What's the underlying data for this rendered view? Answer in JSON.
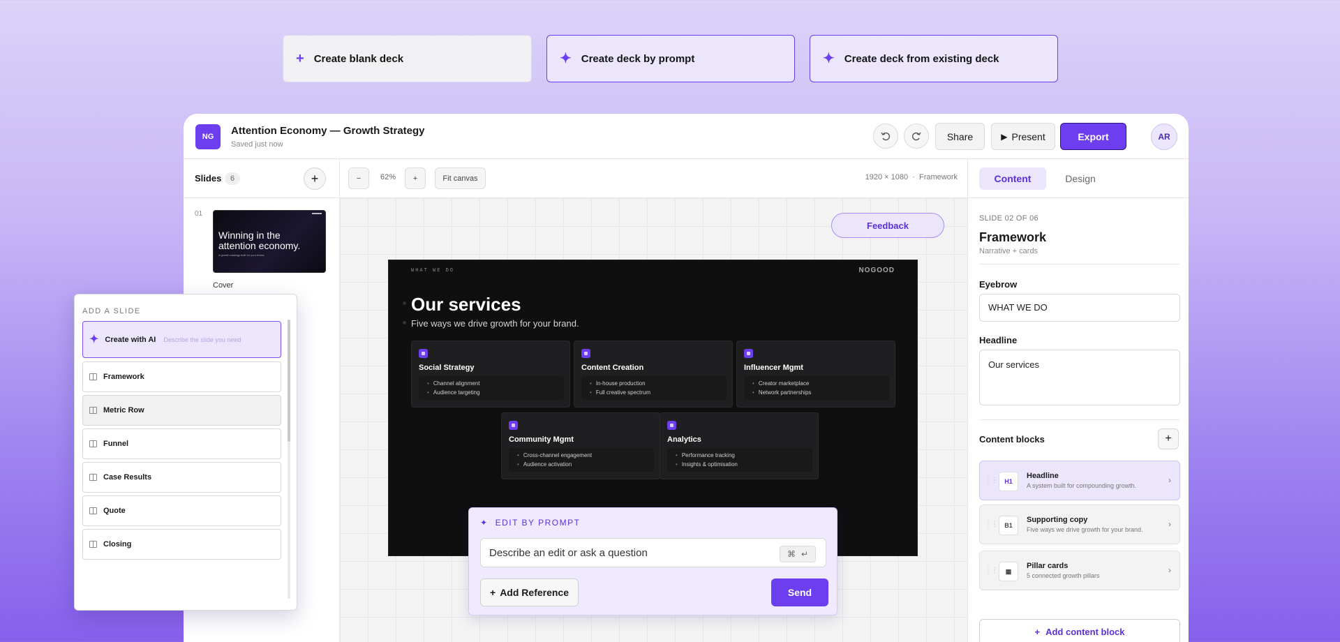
{
  "top_actions": [
    {
      "label": "Create blank deck",
      "icon": "plus-icon"
    },
    {
      "label": "Create deck by prompt",
      "icon": "sparkle-icon"
    },
    {
      "label": "Create deck from existing deck",
      "icon": "sparkle-icon"
    }
  ],
  "header": {
    "logo": "NG",
    "title": "Attention Economy — Growth Strategy",
    "status": "Saved just now",
    "share": "Share",
    "present": "Present",
    "export": "Export",
    "avatar": "AR"
  },
  "sidebar": {
    "title": "Slides",
    "count": "6",
    "slides": [
      {
        "num": "01",
        "name": "Cover",
        "thumb_title": "Winning in the attention economy.",
        "thumb_sub": "A growth strategy built for your brand."
      }
    ]
  },
  "toolbar": {
    "zoom_out": "−",
    "zoom": "62%",
    "zoom_in": "+",
    "fit": "Fit canvas",
    "dimensions": "1920 × 1080  ·  Framework"
  },
  "canvas": {
    "feedback": "Feedback"
  },
  "slide": {
    "eyebrow": "WHAT WE DO",
    "brand": "NOGOOD",
    "title": "Our services",
    "subtitle": "Five ways we drive growth for your brand.",
    "cards": [
      {
        "title": "Social Strategy",
        "items": [
          "Channel alignment",
          "Audience targeting"
        ]
      },
      {
        "title": "Content Creation",
        "items": [
          "In-house production",
          "Full creative spectrum"
        ]
      },
      {
        "title": "Influencer Mgmt",
        "items": [
          "Creator marketplace",
          "Network partnerships"
        ]
      },
      {
        "title": "Community Mgmt",
        "items": [
          "Cross-channel engagement",
          "Audience activation"
        ]
      },
      {
        "title": "Analytics",
        "items": [
          "Performance tracking",
          "Insights & optimisation"
        ]
      }
    ]
  },
  "edit_prompt": {
    "label": "EDIT BY PROMPT",
    "placeholder": "Describe an edit or ask a question",
    "shortcut_cmd": "⌘",
    "shortcut_enter": "↵",
    "add_reference": "Add Reference",
    "send": "Send"
  },
  "add_slide": {
    "title": "ADD A SLIDE",
    "ai_label": "Create with AI",
    "ai_placeholder": "Describe the slide you need",
    "options": [
      "Framework",
      "Metric Row",
      "Funnel",
      "Case Results",
      "Quote",
      "Closing"
    ]
  },
  "right_panel": {
    "tabs": [
      "Content",
      "Design"
    ],
    "meta": "SLIDE 02 OF 06",
    "title": "Framework",
    "subtitle": "Narrative + cards",
    "eyebrow_label": "Eyebrow",
    "eyebrow_value": "WHAT WE DO",
    "headline_label": "Headline",
    "headline_value": "Our services",
    "blocks_label": "Content blocks",
    "blocks": [
      {
        "badge": "H1",
        "title": "Headline",
        "sub": "A system built for compounding growth."
      },
      {
        "badge": "B1",
        "title": "Supporting copy",
        "sub": "Five ways we drive growth for your brand."
      },
      {
        "badge": "▦",
        "title": "Pillar cards",
        "sub": "5 connected growth pillars"
      }
    ],
    "add_block": "Add content block"
  },
  "colors": {
    "accent": "#6d3df0",
    "accent_light": "#ece6fd"
  }
}
